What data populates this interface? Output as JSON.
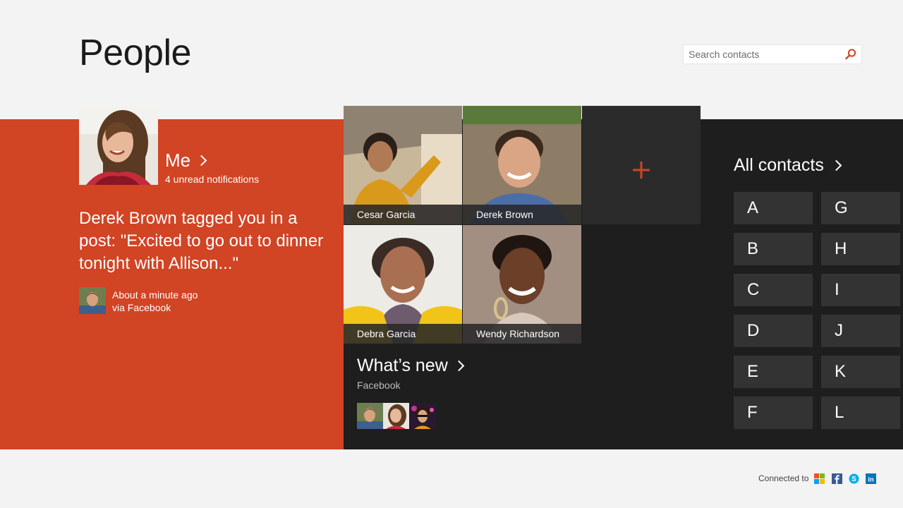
{
  "header": {
    "title": "People",
    "search_placeholder": "Search contacts"
  },
  "me": {
    "label": "Me",
    "notifications": "4 unread notifications",
    "post_text": "Derek Brown tagged you in a post: \"Excited to go out to dinner tonight with Allison...\"",
    "post_time": "About a minute ago",
    "post_source": "via Facebook"
  },
  "favorites": [
    {
      "name": "Cesar Garcia"
    },
    {
      "name": "Derek Brown"
    },
    {
      "name": "Debra Garcia"
    },
    {
      "name": "Wendy Richardson"
    }
  ],
  "add_tile": {
    "icon": "plus-icon"
  },
  "whats_new": {
    "title": "What’s new",
    "source": "Facebook"
  },
  "all_contacts": {
    "title": "All contacts",
    "letters": [
      "A",
      "B",
      "C",
      "D",
      "E",
      "F",
      "G",
      "H",
      "I",
      "J",
      "K",
      "L"
    ]
  },
  "footer": {
    "connected_label": "Connected to",
    "services": [
      "microsoft-icon",
      "facebook-icon",
      "skype-icon",
      "linkedin-icon"
    ]
  },
  "colors": {
    "accent": "#d14424",
    "dark": "#1e1e1e",
    "tile": "#333333",
    "background": "#f3f3f3"
  }
}
